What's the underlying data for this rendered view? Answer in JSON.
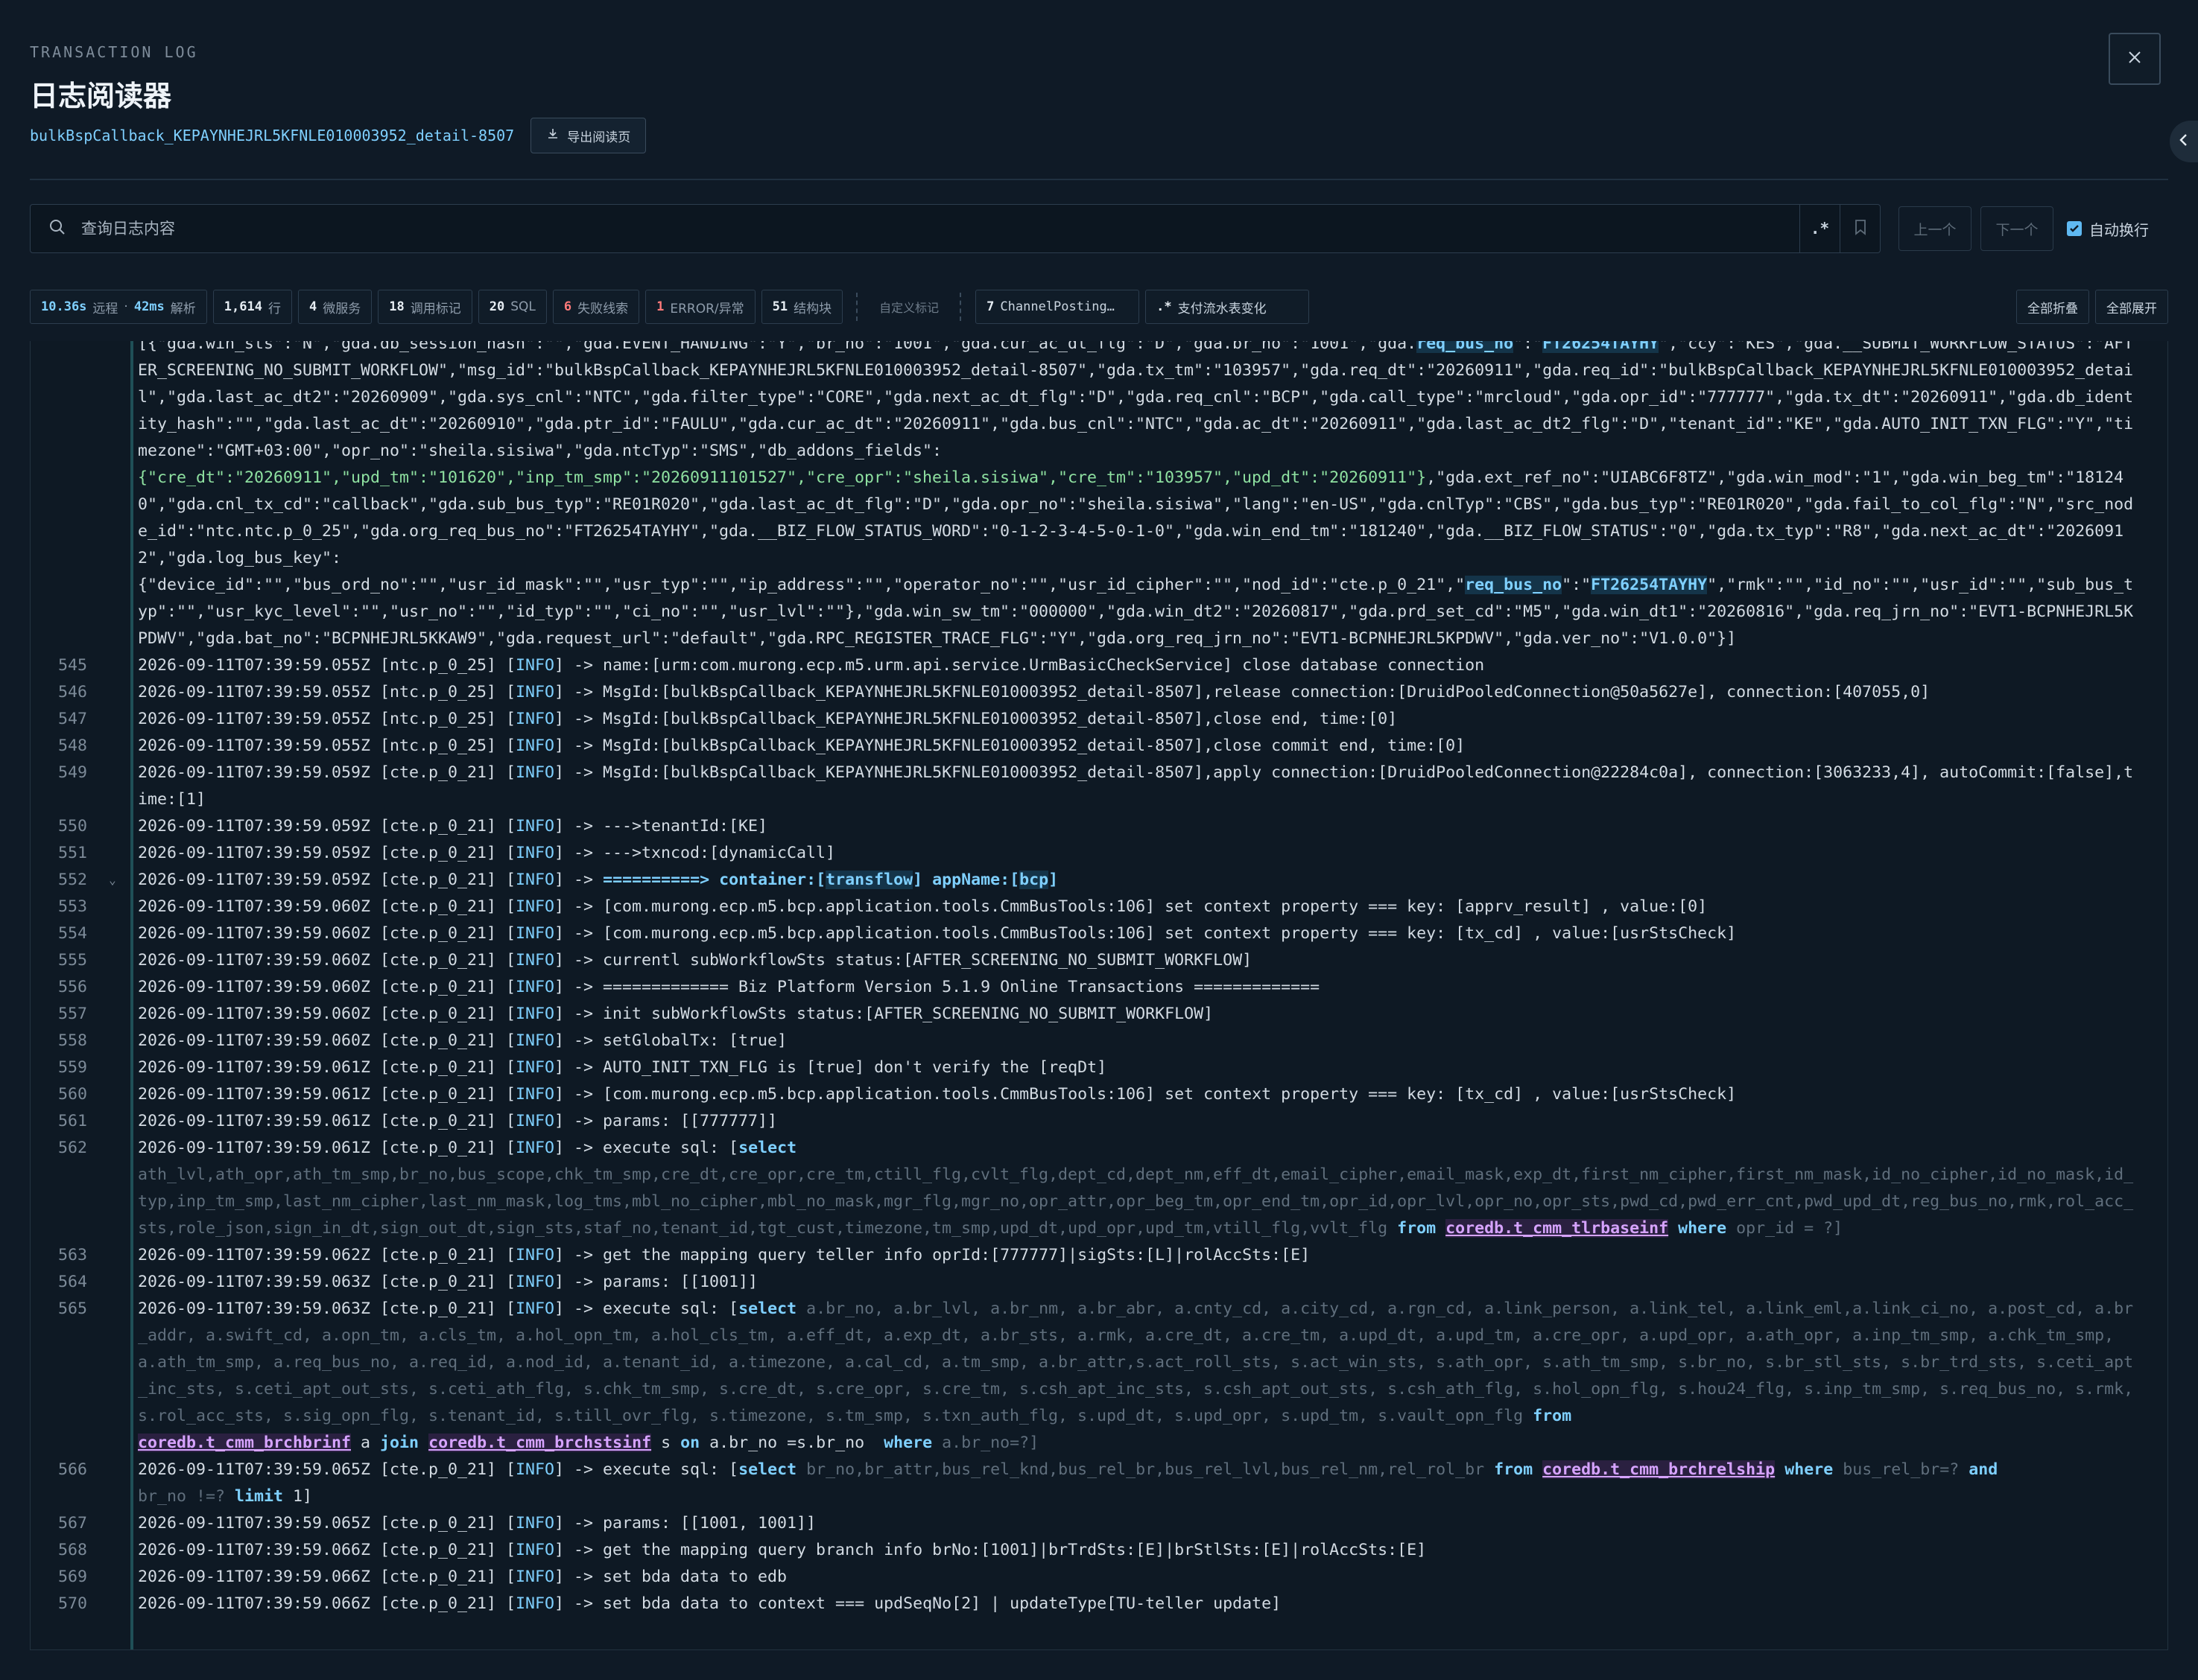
{
  "header": {
    "eyebrow": "TRANSACTION LOG",
    "title": "日志阅读器",
    "log_id": "bulkBspCallback_KEPAYNHEJRL5KFNLE010003952_detail-8507",
    "export_label": "导出阅读页"
  },
  "search": {
    "placeholder": "查询日志内容",
    "regex_label": ".*",
    "prev_label": "上一个",
    "next_label": "下一个",
    "wrap_label": "自动换行",
    "wrap_checked": true
  },
  "stats": {
    "remote_time": "10.36s",
    "remote_label": "远程",
    "parse_time": "42ms",
    "parse_label": "解析",
    "lines_count": "1,614",
    "lines_label": "行",
    "services_count": "4",
    "services_label": "微服务",
    "calls_count": "18",
    "calls_label": "调用标记",
    "sql_count": "20",
    "sql_label": "SQL",
    "fail_count": "6",
    "fail_label": "失败线索",
    "error_count": "1",
    "error_label": "ERROR/异常",
    "struct_count": "51",
    "struct_label": "结构块",
    "custom_label": "自定义标记",
    "marker1_count": "7",
    "marker1_label": "ChannelPosting…",
    "marker2_prefix": ".*",
    "marker2_label": "支付流水表变化",
    "collapse_all": "全部折叠",
    "expand_all": "全部展开"
  },
  "log": {
    "cont_1": "[{\"gda.win_sts\":\"N\",\"gda.db_session_hash\":\"\",\"gda.EVENT_HANDING\":\"Y\",\"br_no\":\"1001\",\"gda.cur_ac_dt_flg\":\"D\",\"gda.br_no\":\"1001\",\"gda.",
    "cont_1b": "req_bus_no",
    "cont_1c": "\":\"",
    "cont_1d": "FT26254TAYHY",
    "cont_1e": "\",\"ccy\":\"KES\",\"gda.__SUBMIT_WORKFLOW_STATUS\":\"AFTER_SCREENING_NO_SUBMIT_WORKFLOW\",\"msg_id\":\"bulkBspCallback_KEPAYNHEJRL5KFNLE010003952_detail-8507\",\"gda.tx_tm\":\"103957\",\"gda.req_dt\":\"20260911\",\"gda.req_id\":\"bulkBspCallback_KEPAYNHEJRL5KFNLE010003952_detail\",\"gda.last_ac_dt2\":\"20260909\",\"gda.sys_cnl\":\"NTC\",\"gda.filter_type\":\"CORE\",\"gda.next_ac_dt_flg\":\"D\",\"gda.req_cnl\":\"BCP\",\"gda.call_type\":\"mrcloud\",\"gda.opr_id\":\"777777\",\"gda.tx_dt\":\"20260911\",\"gda.db_identity_hash\":\"\",\"gda.last_ac_dt\":\"20260910\",\"gda.ptr_id\":\"FAULU\",\"gda.cur_ac_dt\":\"20260911\",\"gda.bus_cnl\":\"NTC\",\"gda.ac_dt\":\"20260911\",\"gda.last_ac_dt2_flg\":\"D\",\"tenant_id\":\"KE\",\"gda.AUTO_INIT_TXN_FLG\":\"Y\",\"timezone\":\"GMT+03:00\",\"opr_no\":\"sheila.sisiwa\",\"gda.ntcTyp\":\"SMS\",\"db_addons_fields\":",
    "cont_2a": "{\"cre_dt\":\"20260911\",\"upd_tm\":\"101620\",\"inp_tm_smp\":\"20260911101527\",\"cre_opr\":\"sheila.sisiwa\",\"cre_tm\":\"103957\",\"upd_dt\":\"20260911\"}",
    "cont_2b": ",\"gda.ext_ref_no\":\"UIABC6F8TZ\",\"gda.win_mod\":\"1\",\"gda.win_beg_tm\":\"181240\",\"gda.cnl_tx_cd\":\"callback\",\"gda.sub_bus_typ\":\"RE01R020\",\"gda.last_ac_dt_flg\":\"D\",\"gda.opr_no\":\"sheila.sisiwa\",\"lang\":\"en-US\",\"gda.cnlTyp\":\"CBS\",\"gda.bus_typ\":\"RE01R020\",\"gda.fail_to_col_flg\":\"N\",\"src_node_id\":\"ntc.ntc.p_0_25\",\"gda.org_req_bus_no\":\"FT26254TAYHY\",\"gda.__BIZ_FLOW_STATUS_WORD\":\"0-1-2-3-4-5-0-1-0\",\"gda.win_end_tm\":\"181240\",\"gda.__BIZ_FLOW_STATUS\":\"0\",\"gda.tx_typ\":\"R8\",\"gda.next_ac_dt\":\"20260912\",\"gda.log_bus_key\":",
    "cont_3a": "{\"device_id\":\"\",\"bus_ord_no\":\"\",\"usr_id_mask\":\"\",\"usr_typ\":\"\",\"ip_address\":\"\",\"operator_no\":\"\",\"usr_id_cipher\":\"\",\"nod_id\":\"cte.p_0_21\",\"",
    "cont_3b": "req_bus_no",
    "cont_3c": "\":\"",
    "cont_3d": "FT26254TAYHY",
    "cont_3e": "\",\"rmk\":\"\",\"id_no\":\"\",\"usr_id\":\"\",\"sub_bus_typ\":\"\",\"usr_kyc_level\":\"\",\"usr_no\":\"\",\"id_typ\":\"\",\"ci_no\":\"\",\"usr_lvl\":\"\"},\"gda.win_sw_tm\":\"000000\",\"gda.win_dt2\":\"20260817\",\"gda.prd_set_cd\":\"M5\",\"gda.win_dt1\":\"20260816\",\"gda.req_jrn_no\":\"EVT1-BCPNHEJRL5KPDWV\",\"gda.bat_no\":\"BCPNHEJRL5KKAW9\",\"gda.request_url\":\"default\",\"gda.RPC_REGISTER_TRACE_FLG\":\"Y\",\"gda.org_req_jrn_no\":\"EVT1-BCPNHEJRL5KPDWV\",\"gda.ver_no\":\"V1.0.0\"}]",
    "l545": "545",
    "t545a": "2026-09-11T07:39:59.055Z [ntc.p_0_25] [",
    "t545b": "] -> name:[urm:com.murong.ecp.m5.urm.api.service.UrmBasicCheckService] close database connection",
    "l546": "546",
    "t546a": "2026-09-11T07:39:59.055Z [ntc.p_0_25] [",
    "t546b": "] -> MsgId:[bulkBspCallback_KEPAYNHEJRL5KFNLE010003952_detail-8507],release connection:[DruidPooledConnection@50a5627e], connection:[407055,0]",
    "l547": "547",
    "t547a": "2026-09-11T07:39:59.055Z [ntc.p_0_25] [",
    "t547b": "] -> MsgId:[bulkBspCallback_KEPAYNHEJRL5KFNLE010003952_detail-8507],close end, time:[0]",
    "l548": "548",
    "t548a": "2026-09-11T07:39:59.055Z [ntc.p_0_25] [",
    "t548b": "] -> MsgId:[bulkBspCallback_KEPAYNHEJRL5KFNLE010003952_detail-8507],close commit end, time:[0]",
    "l549": "549",
    "t549a": "2026-09-11T07:39:59.059Z [cte.p_0_21] [",
    "t549b": "] -> MsgId:[bulkBspCallback_KEPAYNHEJRL5KFNLE010003952_detail-8507],apply connection:[DruidPooledConnection@22284c0a], connection:[3063233,4], autoCommit:[false],time:[1]",
    "l550": "550",
    "t550a": "2026-09-11T07:39:59.059Z [cte.p_0_21] [",
    "t550b": "] -> --->tenantId:[KE]",
    "l551": "551",
    "t551a": "2026-09-11T07:39:59.059Z [cte.p_0_21] [",
    "t551b": "] -> --->txncod:[dynamicCall]",
    "l552": "552",
    "t552a": "2026-09-11T07:39:59.059Z [cte.p_0_21] [",
    "t552b": "] -> ",
    "t552c": "==========> container:[",
    "t552d": "transflow",
    "t552e": "] appName:[",
    "t552f": "bcp",
    "t552g": "]",
    "l553": "553",
    "t553a": "2026-09-11T07:39:59.060Z [cte.p_0_21] [",
    "t553b": "] -> [com.murong.ecp.m5.bcp.application.tools.CmmBusTools:106] set context property === key: [apprv_result] , value:[0]",
    "l554": "554",
    "t554a": "2026-09-11T07:39:59.060Z [cte.p_0_21] [",
    "t554b": "] -> [com.murong.ecp.m5.bcp.application.tools.CmmBusTools:106] set context property === key: [tx_cd] , value:[usrStsCheck]",
    "l555": "555",
    "t555a": "2026-09-11T07:39:59.060Z [cte.p_0_21] [",
    "t555b": "] -> currentl subWorkflowSts status:[AFTER_SCREENING_NO_SUBMIT_WORKFLOW]",
    "l556": "556",
    "t556a": "2026-09-11T07:39:59.060Z [cte.p_0_21] [",
    "t556b": "] -> ============= Biz Platform Version 5.1.9 Online Transactions =============",
    "l557": "557",
    "t557a": "2026-09-11T07:39:59.060Z [cte.p_0_21] [",
    "t557b": "] -> init subWorkflowSts status:[AFTER_SCREENING_NO_SUBMIT_WORKFLOW]",
    "l558": "558",
    "t558a": "2026-09-11T07:39:59.060Z [cte.p_0_21] [",
    "t558b": "] -> setGlobalTx: [true]",
    "l559": "559",
    "t559a": "2026-09-11T07:39:59.061Z [cte.p_0_21] [",
    "t559b": "] -> AUTO_INIT_TXN_FLG is [true] don't verify the [reqDt]",
    "l560": "560",
    "t560a": "2026-09-11T07:39:59.061Z [cte.p_0_21] [",
    "t560b": "] -> [com.murong.ecp.m5.bcp.application.tools.CmmBusTools:106] set context property === key: [tx_cd] , value:[usrStsCheck]",
    "l561": "561",
    "t561a": "2026-09-11T07:39:59.061Z [cte.p_0_21] [",
    "t561b": "] -> params: [[777777]]",
    "l562": "562",
    "t562a": "2026-09-11T07:39:59.061Z [cte.p_0_21] [",
    "t562b": "] -> execute sql: [",
    "t562c": "select",
    "t562d": "\nath_lvl,ath_opr,ath_tm_smp,br_no,bus_scope,chk_tm_smp,cre_dt,cre_opr,cre_tm,ctill_flg,cvlt_flg,dept_cd,dept_nm,eff_dt,email_cipher,email_mask,exp_dt,first_nm_cipher,first_nm_mask,id_no_cipher,id_no_mask,id_typ,inp_tm_smp,last_nm_cipher,last_nm_mask,log_tms,mbl_no_cipher,mbl_no_mask,mgr_flg,mgr_no,opr_attr,opr_beg_tm,opr_end_tm,opr_id,opr_lvl,opr_no,opr_sts,pwd_cd,pwd_err_cnt,pwd_upd_dt,reg_bus_no,rmk,rol_acc_sts,role_json,sign_in_dt,sign_out_dt,sign_sts,staf_no,tenant_id,tgt_cust,timezone,tm_smp,upd_dt,upd_opr,upd_tm,vtill_flg,vvlt_flg ",
    "t562e": "from",
    "t562f": "coredb.t_cmm_tlrbaseinf",
    "t562g": "where",
    "t562h": " opr_id = ?]",
    "l563": "563",
    "t563a": "2026-09-11T07:39:59.062Z [cte.p_0_21] [",
    "t563b": "] -> get the mapping query teller info oprId:[777777]|sigSts:[L]|rolAccSts:[E]",
    "l564": "564",
    "t564a": "2026-09-11T07:39:59.063Z [cte.p_0_21] [",
    "t564b": "] -> params: [[1001]]",
    "l565": "565",
    "t565a": "2026-09-11T07:39:59.063Z [cte.p_0_21] [",
    "t565b": "] -> execute sql: [",
    "t565c": "select",
    "t565d": " a.br_no, a.br_lvl, a.br_nm, a.br_abr, a.cnty_cd, a.city_cd, a.rgn_cd, a.link_person, a.link_tel, a.link_eml,a.link_ci_no, a.post_cd, a.br_addr, a.swift_cd, a.opn_tm, a.cls_tm, a.hol_opn_tm, a.hol_cls_tm, a.eff_dt, a.exp_dt, a.br_sts, a.rmk, a.cre_dt, a.cre_tm, a.upd_dt, a.upd_tm, a.cre_opr, a.upd_opr, a.ath_opr, a.inp_tm_smp, a.chk_tm_smp, a.ath_tm_smp, a.req_bus_no, a.req_id, a.nod_id, a.tenant_id, a.timezone, a.cal_cd, a.tm_smp, a.br_attr,s.act_roll_sts, s.act_win_sts, s.ath_opr, s.ath_tm_smp, s.br_no, s.br_stl_sts, s.br_trd_sts, s.ceti_apt_inc_sts, s.ceti_apt_out_sts, s.ceti_ath_flg, s.chk_tm_smp, s.cre_dt, s.cre_opr, s.cre_tm, s.csh_apt_inc_sts, s.csh_apt_out_sts, s.csh_ath_flg, s.hol_opn_flg, s.hou24_flg, s.inp_tm_smp, s.req_bus_no, s.rmk, s.rol_acc_sts, s.sig_opn_flg, s.tenant_id, s.till_ovr_flg, s.timezone, s.tm_smp, s.txn_auth_flg, s.upd_dt, s.upd_opr, s.upd_tm, s.vault_opn_flg ",
    "t565e": "from",
    "t565f": "coredb.t_cmm_brchbrinf",
    "t565g": " a ",
    "t565h": "join",
    "t565i": "coredb.t_cmm_brchstsinf",
    "t565j": " s ",
    "t565k": "on",
    "t565l": " a.br_no =s.br_no  ",
    "t565m": "where",
    "t565n": " a.br_no=?]",
    "l566": "566",
    "t566a": "2026-09-11T07:39:59.065Z [cte.p_0_21] [",
    "t566b": "] -> execute sql: [",
    "t566c": "select",
    "t566d": " br_no,br_attr,bus_rel_knd,bus_rel_br,bus_rel_lvl,bus_rel_nm,rel_rol_br ",
    "t566e": "from",
    "t566f": "coredb.t_cmm_brchrelship",
    "t566g": "where",
    "t566h": " bus_rel_br=? ",
    "t566i": "and",
    "t566j": "\nbr_no !=? ",
    "t566k": "limit",
    "t566l": " 1]",
    "l567": "567",
    "t567a": "2026-09-11T07:39:59.065Z [cte.p_0_21] [",
    "t567b": "] -> params: [[1001, 1001]]",
    "l568": "568",
    "t568a": "2026-09-11T07:39:59.066Z [cte.p_0_21] [",
    "t568b": "] -> get the mapping query branch info brNo:[1001]|brTrdSts:[E]|brStlSts:[E]|rolAccSts:[E]",
    "l569": "569",
    "t569a": "2026-09-11T07:39:59.066Z [cte.p_0_21] [",
    "t569b": "] -> set bda data to edb",
    "l570": "570",
    "t570a": "2026-09-11T07:39:59.066Z [cte.p_0_21] [",
    "t570b": "] -> set bda data to context === updSeqNo[2] | updateType[TU-teller update]",
    "level": "INFO",
    "fold_symbol": "⌄"
  }
}
